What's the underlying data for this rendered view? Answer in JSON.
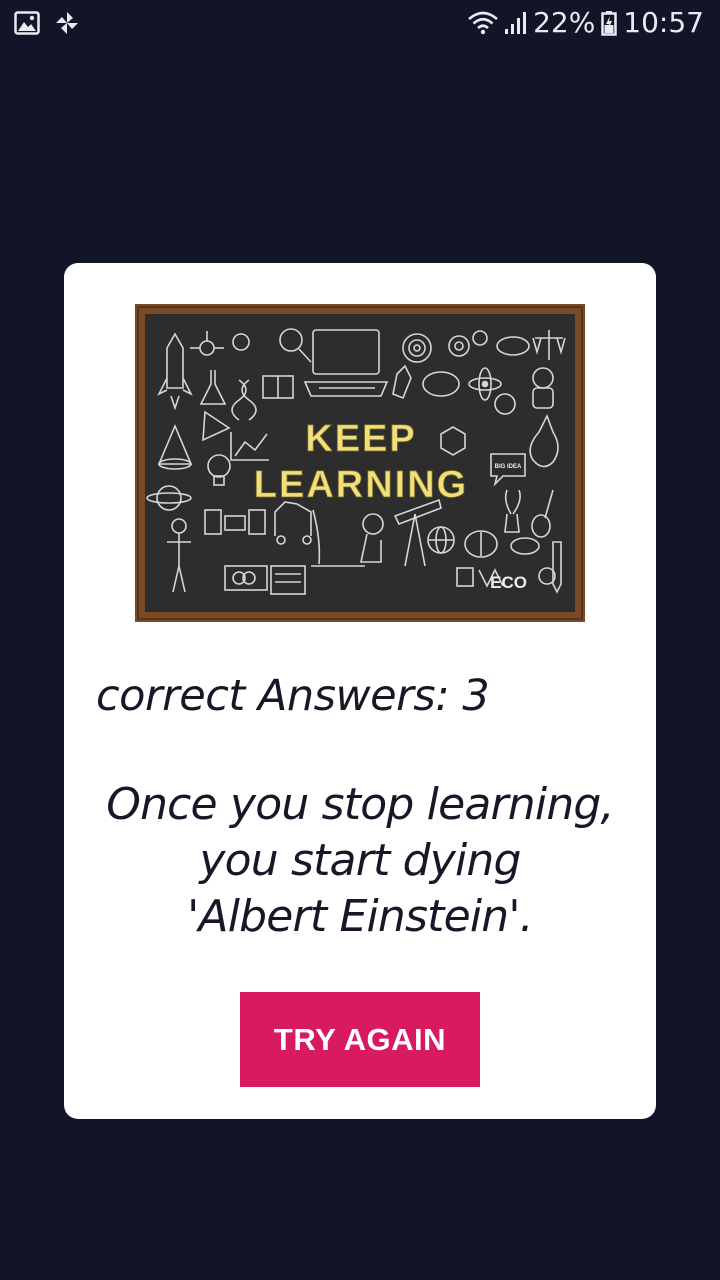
{
  "status_bar": {
    "battery_text": "22%",
    "time": "10:57",
    "icons": [
      "image-icon",
      "pinwheel-icon",
      "wifi-icon",
      "signal-icon",
      "battery-icon"
    ]
  },
  "result": {
    "image_caption_line1": "KEEP",
    "image_caption_line2": "LEARNING",
    "eco_text": "ECO",
    "big_idea_text": "BIG IDEA",
    "score_text": "correct Answers: 3",
    "quote_lines": [
      "Once you stop learning,",
      "you start dying",
      "'Albert Einstein'."
    ],
    "try_again_label": "TRY AGAIN"
  },
  "colors": {
    "background": "#121427",
    "card": "#ffffff",
    "button": "#d81b5e",
    "chalkboard": "#2d2d2d",
    "frame": "#7a4a26",
    "chalk_yellow": "#f1e07a"
  }
}
